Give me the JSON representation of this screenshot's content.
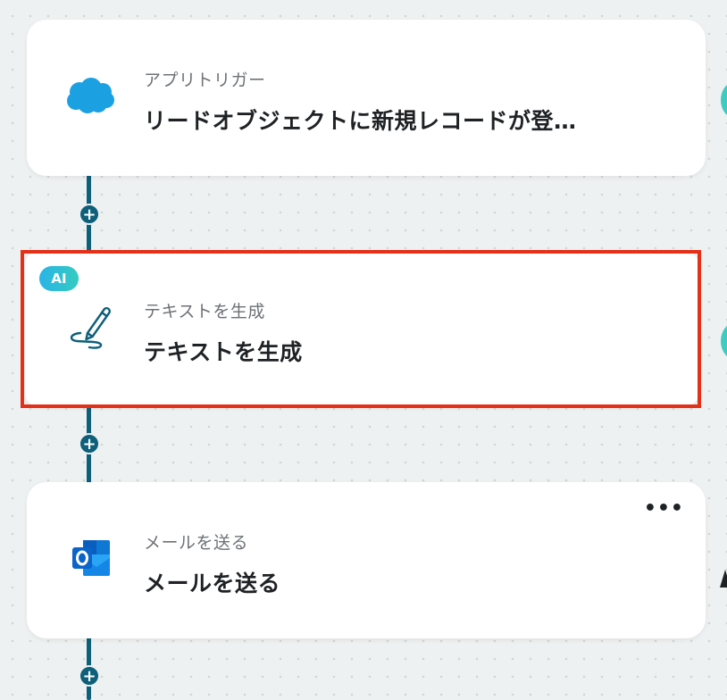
{
  "steps": [
    {
      "subtitle": "アプリトリガー",
      "title": "リードオブジェクトに新規レコードが登…",
      "icon": "salesforce-cloud-icon"
    },
    {
      "badge": "AI",
      "subtitle": "テキストを生成",
      "title": "テキストを生成",
      "icon": "pen-scribble-icon",
      "selected": true
    },
    {
      "subtitle": "メールを送る",
      "title": "メールを送る",
      "icon": "outlook-icon",
      "menu": "•••"
    }
  ],
  "add_button_symbol": "+",
  "colors": {
    "connector": "#0d5f7a",
    "selection": "#e53018",
    "ai_badge": "#2ab4e6",
    "salesforce": "#1ba1e2",
    "outlook": "#0a64c9"
  }
}
